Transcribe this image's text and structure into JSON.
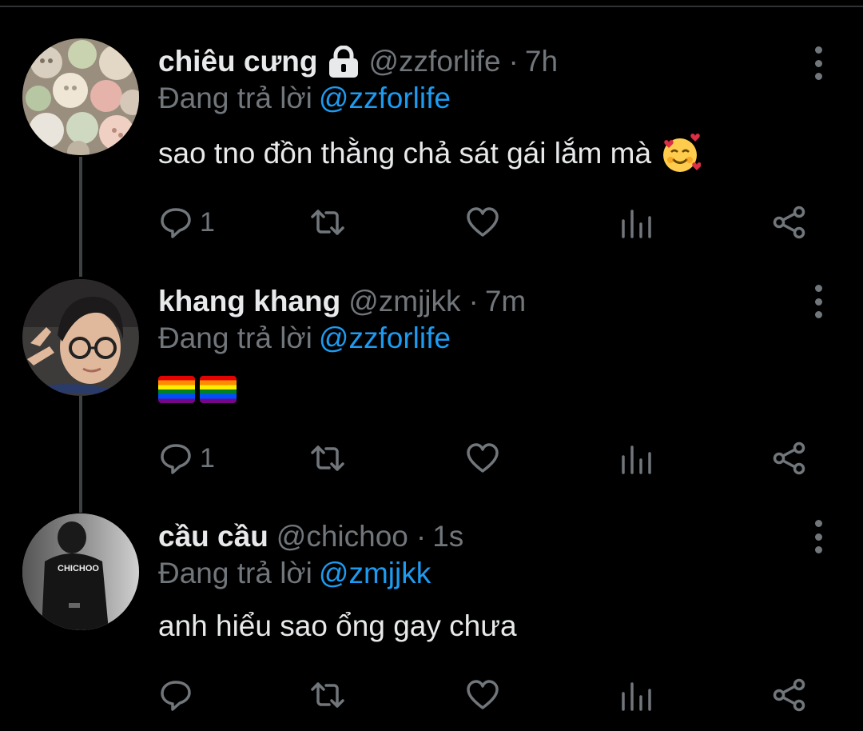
{
  "replying_label": "Đang trả lời",
  "tweets": [
    {
      "name": "chiêu cưng",
      "handle": "@zzforlife",
      "time": "7h",
      "protected": true,
      "reply_to": "@zzforlife",
      "text": "sao tno đồn thằng chả sát gái lắm mà",
      "text_emoji": "smiling-face-with-hearts",
      "reply_count": "1",
      "avatar": "buttons-avatar"
    },
    {
      "name": "khang khang",
      "handle": "@zmjjkk",
      "time": "7m",
      "protected": false,
      "reply_to": "@zzforlife",
      "text": "",
      "text_emoji": "rainbow-flag rainbow-flag",
      "reply_count": "1",
      "avatar": "man-glasses-avatar"
    },
    {
      "name": "cầu cầu",
      "handle": "@chichoo",
      "time": "1s",
      "protected": false,
      "reply_to": "@zmjjkk",
      "text": "anh hiểu sao ổng gay chưa",
      "text_emoji": "",
      "reply_count": "",
      "avatar": "chichoo-jersey-avatar"
    }
  ],
  "colors": {
    "background": "#000000",
    "text": "#e7e9ea",
    "secondary": "#71767b",
    "link": "#1d9bf0",
    "thread_line": "#3e4144"
  },
  "icons": [
    "lock-icon",
    "more-icon",
    "reply-icon",
    "retweet-icon",
    "like-icon",
    "analytics-icon",
    "share-icon"
  ]
}
